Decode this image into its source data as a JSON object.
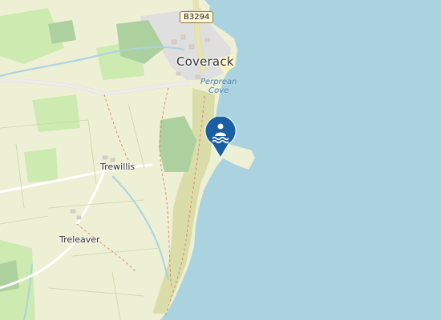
{
  "map": {
    "labels": {
      "coverack": "Coverack",
      "perprean_cove_line1": "Perprean",
      "perprean_cove_line2": "Cove",
      "trewillis": "Trewillis",
      "treleaver": "Treleaver"
    },
    "road_ref": "B3294",
    "marker": {
      "icon": "swimming-icon",
      "color": "#1a5fa3"
    },
    "colors": {
      "sea": "#aad3df",
      "farmland": "#eef0d5",
      "grass": "#cdebb0",
      "wood": "#add19e",
      "heath": "#d6d99f",
      "residential": "#e0dfdf",
      "beach": "#fff1ba"
    }
  }
}
